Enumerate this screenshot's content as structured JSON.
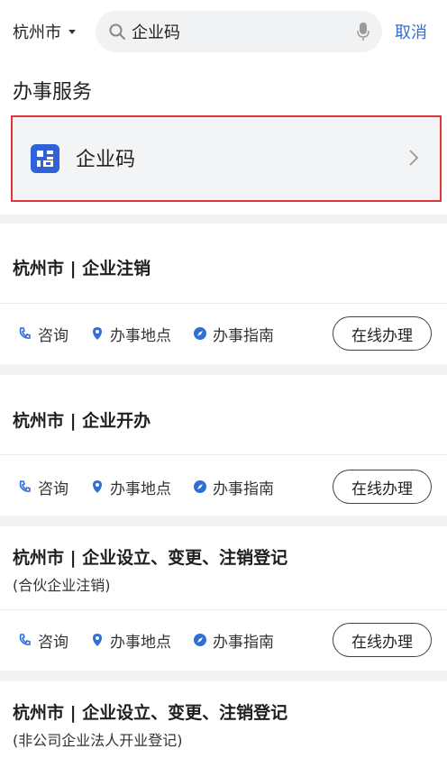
{
  "topbar": {
    "city": "杭州市",
    "search_query": "企业码",
    "cancel": "取消"
  },
  "service_section": {
    "heading": "办事服务",
    "item_label": "企业码"
  },
  "cards": [
    {
      "title": "杭州市 | 企业注销",
      "subtitle": "",
      "actions": {
        "consult": "咨询",
        "location": "办事地点",
        "guide": "办事指南",
        "online": "在线办理"
      }
    },
    {
      "title": "杭州市 | 企业开办",
      "subtitle": "",
      "actions": {
        "consult": "咨询",
        "location": "办事地点",
        "guide": "办事指南",
        "online": "在线办理"
      }
    },
    {
      "title": "杭州市 | 企业设立、变更、注销登记",
      "subtitle": "(合伙企业注销)",
      "actions": {
        "consult": "咨询",
        "location": "办事地点",
        "guide": "办事指南",
        "online": "在线办理"
      }
    },
    {
      "title": "杭州市 | 企业设立、变更、注销登记",
      "subtitle": "(非公司企业法人开业登记)"
    }
  ],
  "colors": {
    "accent": "#2f6fd6",
    "icon_blue": "#2f62d9",
    "highlight_border": "#e03838"
  }
}
